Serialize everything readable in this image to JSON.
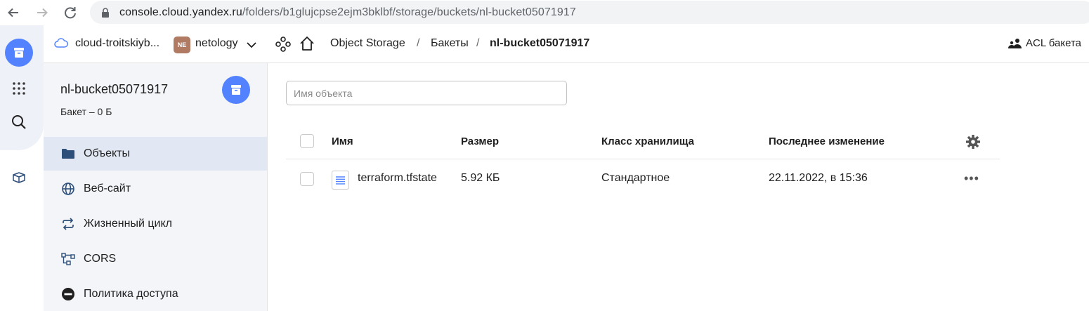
{
  "browser": {
    "url_host": "console.cloud.yandex.ru",
    "url_path": "/folders/b1glujcpse2ejm3bklbf/storage/buckets/nl-bucket05071917"
  },
  "header": {
    "cloud_name": "cloud-troitskiyb...",
    "folder_avatar": "NE",
    "folder_name": "netology",
    "breadcrumbs": [
      "Object Storage",
      "Бакеты",
      "nl-bucket05071917"
    ],
    "separator": "/",
    "acl_label": "ACL бакета"
  },
  "sidebar": {
    "bucket_name": "nl-bucket05071917",
    "bucket_info": "Бакет – 0 Б",
    "items": [
      {
        "label": "Объекты",
        "icon": "folder-icon",
        "active": true
      },
      {
        "label": "Веб-сайт",
        "icon": "globe-icon",
        "active": false
      },
      {
        "label": "Жизненный цикл",
        "icon": "cycle-icon",
        "active": false
      },
      {
        "label": "CORS",
        "icon": "cors-icon",
        "active": false
      },
      {
        "label": "Политика доступа",
        "icon": "policy-icon",
        "active": false
      }
    ]
  },
  "main": {
    "search_placeholder": "Имя объекта",
    "columns": [
      "Имя",
      "Размер",
      "Класс хранилища",
      "Последнее изменение"
    ],
    "rows": [
      {
        "name": "terraform.tfstate",
        "size": "5.92 КБ",
        "storage_class": "Стандартное",
        "modified": "22.11.2022, в 15:36"
      }
    ],
    "row_menu": "•••"
  },
  "colors": {
    "accent": "#5282ff",
    "rail_bg": "#eef1f7",
    "sidebar_bg": "#f3f5f8",
    "active_item_bg": "#e2e8f3",
    "folder_icon": "#2d4f7a"
  }
}
